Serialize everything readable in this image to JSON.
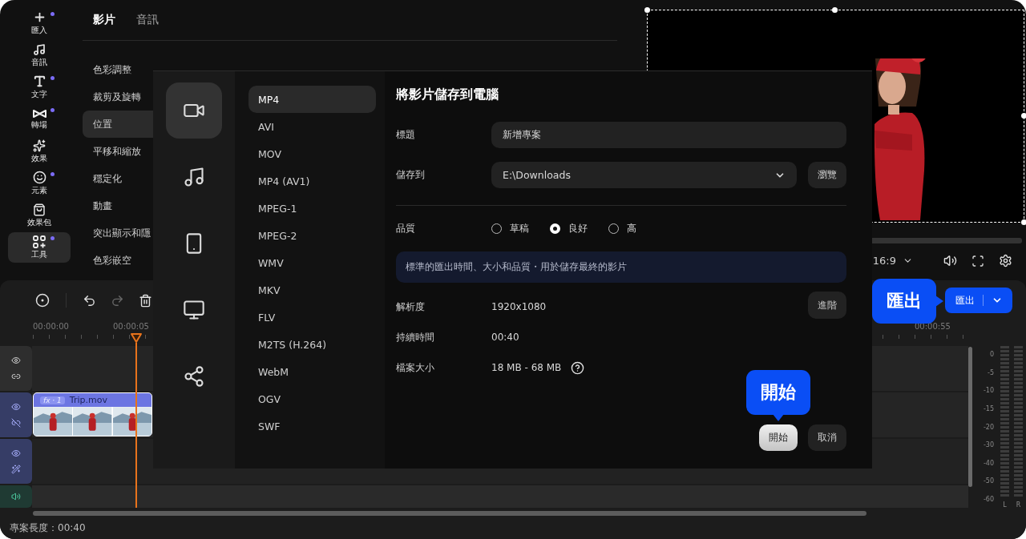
{
  "sidebar": {
    "items": [
      {
        "label": "匯入",
        "badge": true,
        "selected": false
      },
      {
        "label": "音訊",
        "badge": false,
        "selected": false
      },
      {
        "label": "文字",
        "badge": true,
        "selected": false
      },
      {
        "label": "轉場",
        "badge": true,
        "selected": false
      },
      {
        "label": "效果",
        "badge": false,
        "selected": false
      },
      {
        "label": "元素",
        "badge": true,
        "selected": false
      },
      {
        "label": "效果包",
        "badge": false,
        "selected": false
      },
      {
        "label": "工具",
        "badge": true,
        "selected": true
      }
    ]
  },
  "properties": {
    "tabs": [
      {
        "label": "影片",
        "selected": true
      },
      {
        "label": "音訊",
        "selected": false
      }
    ],
    "items": [
      {
        "label": "色彩調整",
        "selected": false
      },
      {
        "label": "裁剪及旋轉",
        "selected": false
      },
      {
        "label": "位置",
        "selected": true
      },
      {
        "label": "平移和縮放",
        "selected": false
      },
      {
        "label": "穩定化",
        "selected": false
      },
      {
        "label": "動畫",
        "selected": false
      },
      {
        "label": "突出顯示和隱",
        "selected": false
      },
      {
        "label": "色彩嵌空",
        "selected": false
      }
    ]
  },
  "preview": {
    "aspect": "16:9"
  },
  "timeline": {
    "ruler": [
      "00:00:00",
      "00:00:05",
      "00:00:55"
    ],
    "export_button": "匯出",
    "tracks": [
      {
        "kind": "plain"
      },
      {
        "kind": "video"
      },
      {
        "kind": "effect"
      },
      {
        "kind": "audio"
      }
    ],
    "clip": {
      "badge": "fx · 1",
      "name": "Trip.mov"
    },
    "meter": {
      "scale": [
        "0",
        "-5",
        "-10",
        "-15",
        "-20",
        "-30",
        "-40",
        "-50",
        "-60"
      ],
      "channels": [
        "L",
        "R"
      ]
    },
    "status": "專案長度：00:40"
  },
  "dialog": {
    "categories": [
      {
        "selected": true
      },
      {
        "selected": false
      },
      {
        "selected": false
      },
      {
        "selected": false
      },
      {
        "selected": false
      }
    ],
    "formats": [
      {
        "label": "MP4",
        "selected": true
      },
      {
        "label": "AVI",
        "selected": false
      },
      {
        "label": "MOV",
        "selected": false
      },
      {
        "label": "MP4 (AV1)",
        "selected": false
      },
      {
        "label": "MPEG-1",
        "selected": false
      },
      {
        "label": "MPEG-2",
        "selected": false
      },
      {
        "label": "WMV",
        "selected": false
      },
      {
        "label": "MKV",
        "selected": false
      },
      {
        "label": "FLV",
        "selected": false
      },
      {
        "label": "M2TS (H.264)",
        "selected": false
      },
      {
        "label": "WebM",
        "selected": false
      },
      {
        "label": "OGV",
        "selected": false
      },
      {
        "label": "SWF",
        "selected": false
      }
    ],
    "title": "將影片儲存到電腦",
    "name_field": {
      "label": "標題",
      "value": "新增專案"
    },
    "save_to": {
      "label": "儲存到",
      "value": "E:\\Downloads",
      "browse": "瀏覽"
    },
    "quality": {
      "label": "品質",
      "options": [
        {
          "label": "草稿",
          "selected": false
        },
        {
          "label": "良好",
          "selected": true
        },
        {
          "label": "高",
          "selected": false
        }
      ]
    },
    "hint": "標準的匯出時間、大小和品質・用於儲存最終的影片",
    "info": [
      {
        "label": "解析度",
        "value": "1920x1080",
        "help": false
      },
      {
        "label": "持續時間",
        "value": "00:40",
        "help": false
      },
      {
        "label": "檔案大小",
        "value": "18 MB - 68 MB",
        "help": true
      }
    ],
    "advanced": "進階",
    "start": "開始",
    "cancel": "取消"
  },
  "callouts": [
    {
      "text": "匯出",
      "kind": "side"
    },
    {
      "text": "開始",
      "kind": "below"
    }
  ]
}
